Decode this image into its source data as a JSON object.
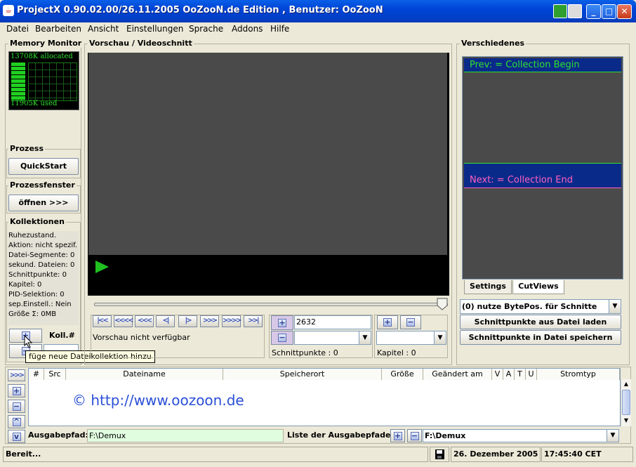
{
  "window": {
    "title": "ProjectX 0.90.02.00/26.11.2005 OoZooN.de Edition , Benutzer: OoZooN"
  },
  "menu": [
    {
      "label": "Datei"
    },
    {
      "label": "Bearbeiten"
    },
    {
      "label": "Ansicht"
    },
    {
      "label": "Einstellungen"
    },
    {
      "label": "Sprache"
    },
    {
      "label": "Addons"
    },
    {
      "label": "Hilfe"
    }
  ],
  "memory": {
    "title": "Memory Monitor",
    "allocated": "13708K allocated",
    "used": "11905K used"
  },
  "prozess": {
    "title": "Prozess",
    "button": "QuickStart"
  },
  "prozessfenster": {
    "title": "Prozessfenster",
    "button": "öffnen >>>"
  },
  "kollektionen": {
    "title": "Kollektionen",
    "lines": [
      "Ruhezustand.",
      "Aktion: nicht spezif.",
      "Datei-Segmente: 0",
      "sekund. Dateien: 0",
      "Schnittpunkte: 0",
      "Kapitel: 0",
      "PID-Selektion: 0",
      "sep.Einstell.: Nein",
      "Größe Σ: 0MB"
    ],
    "koll_label": "Koll.#",
    "tooltip": "füge neue Dateikollektion hinzu"
  },
  "preview": {
    "title": "Vorschau / Videoschnitt",
    "status": "Vorschau nicht verfügbar",
    "cut_value": "2632",
    "schnittpunkte": "Schnittpunkte :  0",
    "kapitel": "Kapitel :  0",
    "nav_buttons": [
      "|<<",
      "<<<<",
      "<<<",
      "<|",
      "|>",
      ">>>",
      ">>>>",
      ">>|"
    ]
  },
  "verschiedenes": {
    "title": "Verschiedenes",
    "prev": "Prev: = Collection Begin",
    "next": "Next: = Collection End",
    "tabs": [
      "Settings",
      "CutViews"
    ],
    "combo": "(0) nutze BytePos. für Schnitte",
    "load_btn": "Schnittpunkte aus Datei laden",
    "save_btn": "Schnittpunkte in Datei speichern"
  },
  "table": {
    "columns": [
      "#",
      "Src",
      "Dateiname",
      "Speicherort",
      "Größe",
      "Geändert am",
      "V",
      "A",
      "T",
      "U",
      "Stromtyp"
    ],
    "watermark": "© http://www.oozoon.de"
  },
  "output": {
    "label": "Ausgabepfad:",
    "value": "F:\\Demux",
    "list_label": "Liste der Ausgabepfade:",
    "list_value": "F:\\Demux"
  },
  "statusbar": {
    "text": "Bereit...",
    "date": "26. Dezember 2005",
    "time": "17:45:40 CET"
  },
  "colors": {
    "title_blue": "#0a4fe0",
    "preview_dark": "#4a4a4a",
    "play_green": "#20c020",
    "prev_text": "#30e030",
    "next_text": "#ff60c0",
    "collection_bar": "#0a2a8a"
  }
}
